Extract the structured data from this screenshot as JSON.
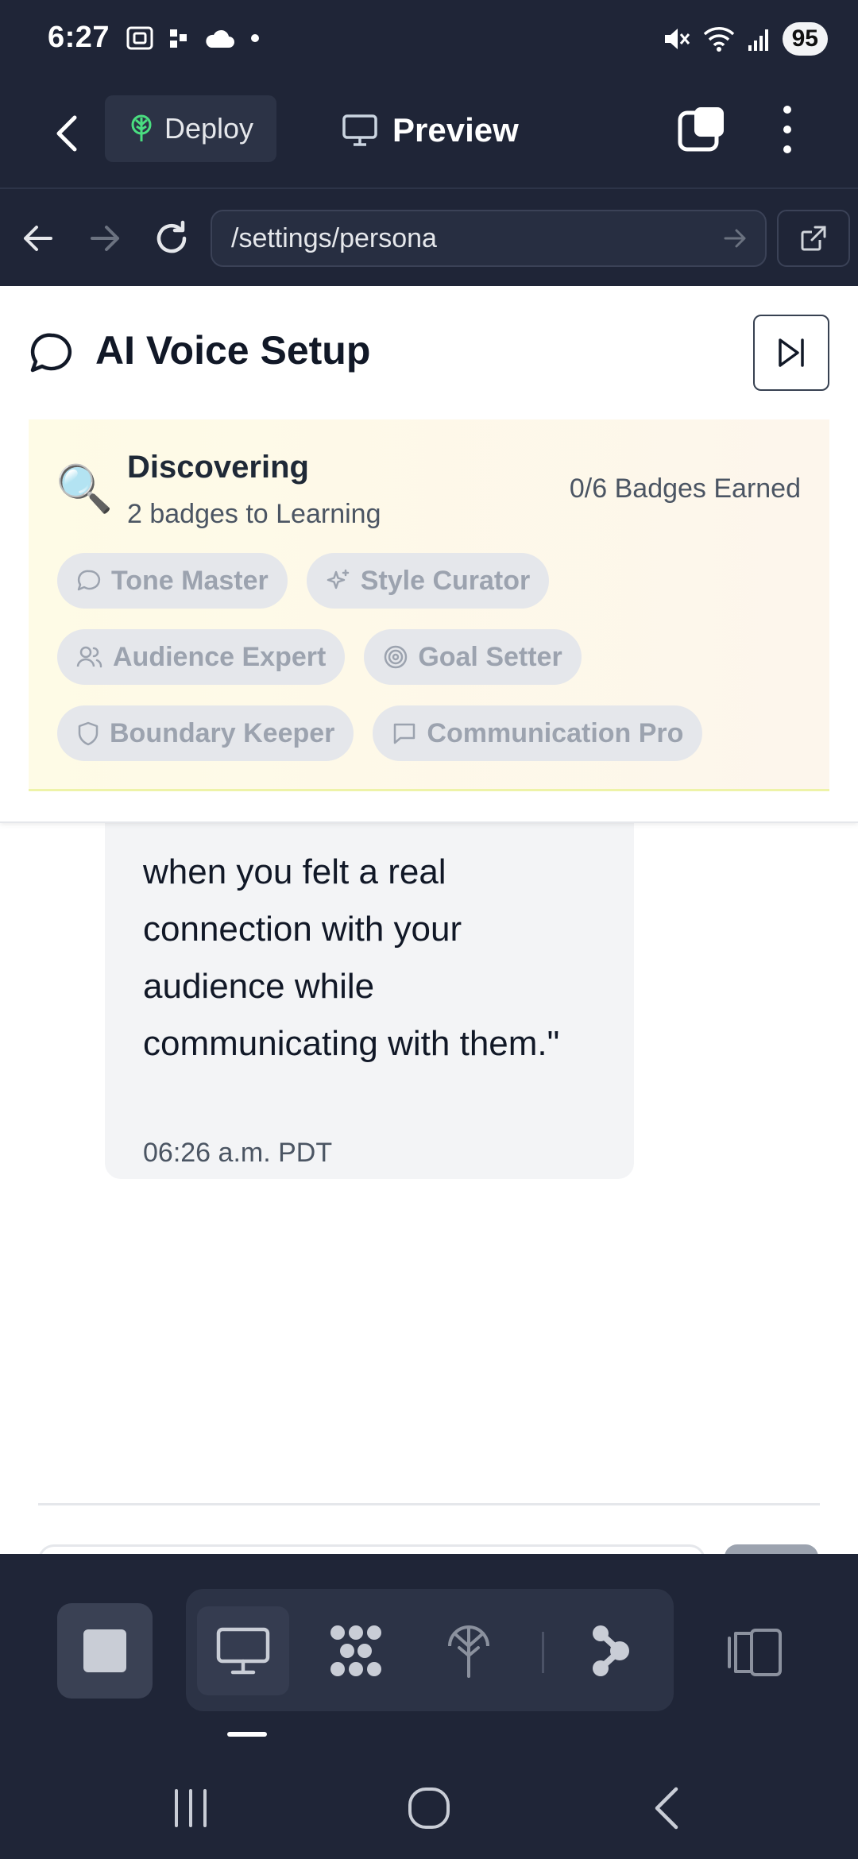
{
  "status_bar": {
    "time": "6:27",
    "battery": "95"
  },
  "app_bar": {
    "deploy_label": "Deploy",
    "preview_label": "Preview"
  },
  "url_bar": {
    "url": "/settings/persona"
  },
  "page": {
    "title": "AI Voice Setup",
    "progress": {
      "level_title": "Discovering",
      "level_subtitle": "2 badges to Learning",
      "earned_text": "0/6 Badges Earned",
      "badges": [
        {
          "label": "Tone Master",
          "icon": "chat-bubble-icon"
        },
        {
          "label": "Style Curator",
          "icon": "sparkle-icon"
        },
        {
          "label": "Audience Expert",
          "icon": "users-icon"
        },
        {
          "label": "Goal Setter",
          "icon": "target-icon"
        },
        {
          "label": "Boundary Keeper",
          "icon": "shield-icon"
        },
        {
          "label": "Communication Pro",
          "icon": "message-square-icon"
        }
      ]
    },
    "message": {
      "text": "when you felt a real connection with your audience while communicating with them.\"",
      "time": "06:26 a.m. PDT"
    }
  },
  "colors": {
    "chrome": "#1f2537",
    "card_bg": "#fefbe6",
    "badge_bg": "#e5e7eb",
    "badge_text": "#9ca3af",
    "deploy_icon": "#4ade80"
  }
}
